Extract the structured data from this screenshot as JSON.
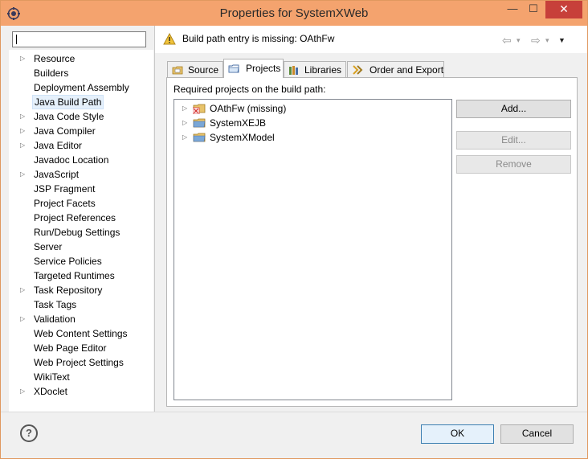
{
  "window": {
    "title": "Properties for SystemXWeb",
    "minimize_glyph": "—",
    "maximize_glyph": "☐",
    "close_glyph": "✕"
  },
  "filter": {
    "value": ""
  },
  "nav": {
    "items": [
      {
        "label": "Resource",
        "expandable": true
      },
      {
        "label": "Builders",
        "expandable": false
      },
      {
        "label": "Deployment Assembly",
        "expandable": false
      },
      {
        "label": "Java Build Path",
        "expandable": false,
        "selected": true
      },
      {
        "label": "Java Code Style",
        "expandable": true
      },
      {
        "label": "Java Compiler",
        "expandable": true
      },
      {
        "label": "Java Editor",
        "expandable": true
      },
      {
        "label": "Javadoc Location",
        "expandable": false
      },
      {
        "label": "JavaScript",
        "expandable": true
      },
      {
        "label": "JSP Fragment",
        "expandable": false
      },
      {
        "label": "Project Facets",
        "expandable": false
      },
      {
        "label": "Project References",
        "expandable": false
      },
      {
        "label": "Run/Debug Settings",
        "expandable": false
      },
      {
        "label": "Server",
        "expandable": false
      },
      {
        "label": "Service Policies",
        "expandable": false
      },
      {
        "label": "Targeted Runtimes",
        "expandable": false
      },
      {
        "label": "Task Repository",
        "expandable": true
      },
      {
        "label": "Task Tags",
        "expandable": false
      },
      {
        "label": "Validation",
        "expandable": true
      },
      {
        "label": "Web Content Settings",
        "expandable": false
      },
      {
        "label": "Web Page Editor",
        "expandable": false
      },
      {
        "label": "Web Project Settings",
        "expandable": false
      },
      {
        "label": "WikiText",
        "expandable": false
      },
      {
        "label": "XDoclet",
        "expandable": true
      }
    ]
  },
  "message": {
    "text": "Build path entry is missing: OAthFw",
    "back_glyph": "⇦",
    "forward_glyph": "⇨",
    "dropdown_glyph": "▾",
    "menu_glyph": "▼"
  },
  "tabs": [
    {
      "label": "Source",
      "icon": "source-folder-icon"
    },
    {
      "label": "Projects",
      "icon": "projects-folder-icon",
      "active": true
    },
    {
      "label": "Libraries",
      "icon": "libraries-icon"
    },
    {
      "label": "Order and Export",
      "icon": "order-export-icon"
    }
  ],
  "projects_tab": {
    "heading": "Required projects on the build path:",
    "projects": [
      {
        "label": "OAthFw (missing)",
        "missing": true
      },
      {
        "label": "SystemXEJB",
        "missing": false
      },
      {
        "label": "SystemXModel",
        "missing": false
      }
    ],
    "buttons": {
      "add": "Add...",
      "edit": "Edit...",
      "remove": "Remove"
    }
  },
  "footer": {
    "help_glyph": "?",
    "ok": "OK",
    "cancel": "Cancel"
  },
  "colors": {
    "titlebar": "#f4a36e",
    "close": "#c7403a",
    "warning": "#f2c43a",
    "folder": "#e8c36a",
    "missing": "#d83a3a"
  }
}
